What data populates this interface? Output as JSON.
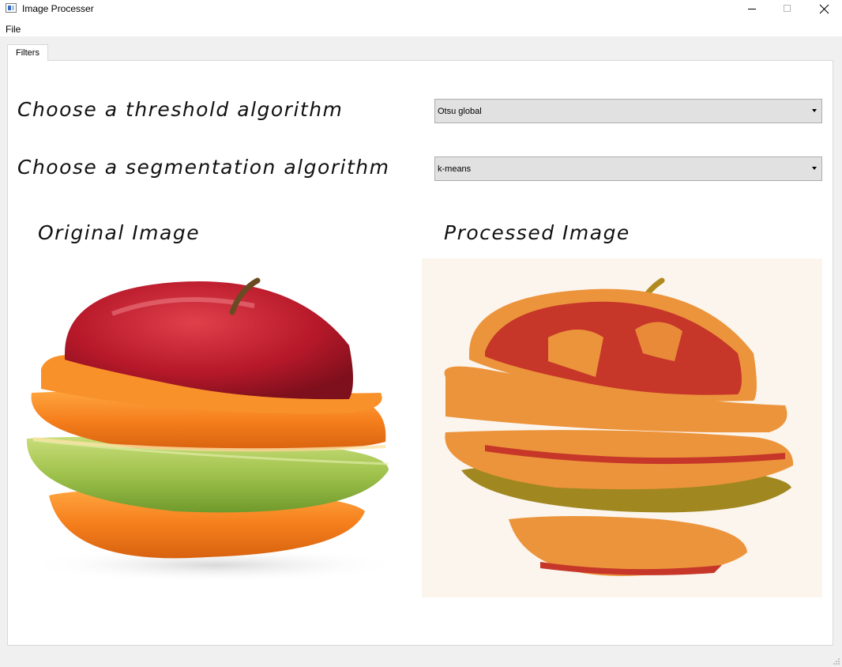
{
  "window": {
    "title": "Image Processer"
  },
  "menu": {
    "file_label": "File"
  },
  "tabs": [
    {
      "label": "Filters",
      "active": true
    }
  ],
  "threshold": {
    "label": "Choose a threshold algorithm",
    "selected": "Otsu global"
  },
  "segmentation": {
    "label": "Choose a segmentation algorithm",
    "selected": "k-means"
  },
  "images": {
    "original_title": "Original Image",
    "processed_title": "Processed Image"
  },
  "icons": {
    "window": "window-icon",
    "minimize": "minimize-icon",
    "maximize": "maximize-icon",
    "close": "close-icon",
    "dropdown": "chevron-down-icon",
    "resize": "resize-grip-icon"
  },
  "colors": {
    "processed_orange": "#ec943b",
    "processed_red": "#c6372a",
    "processed_olive": "#a0871f",
    "processed_background": "#fbf5ee",
    "apple_red": "#b8192a",
    "orange_peel": "#f57f1c",
    "green_apple": "#9fc24c"
  }
}
